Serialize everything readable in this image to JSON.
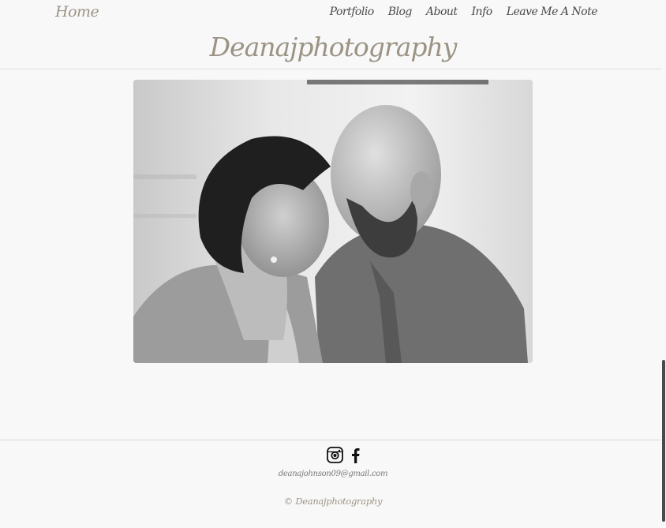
{
  "nav": {
    "home_label": "Home",
    "menu": [
      {
        "label": "Portfolio"
      },
      {
        "label": "Blog"
      },
      {
        "label": "About"
      },
      {
        "label": "Info"
      },
      {
        "label": "Leave Me A Note"
      }
    ]
  },
  "brand": {
    "title": "Deanajphotography"
  },
  "footer": {
    "social_icons": [
      "instagram-icon",
      "facebook-icon"
    ],
    "email": "deanajohnson09@gmail.com",
    "copyright": "© Deanajphotography"
  },
  "colors": {
    "accent": "#9b9384",
    "nav_text": "#4b4b4b",
    "background": "#f8f8f8"
  }
}
